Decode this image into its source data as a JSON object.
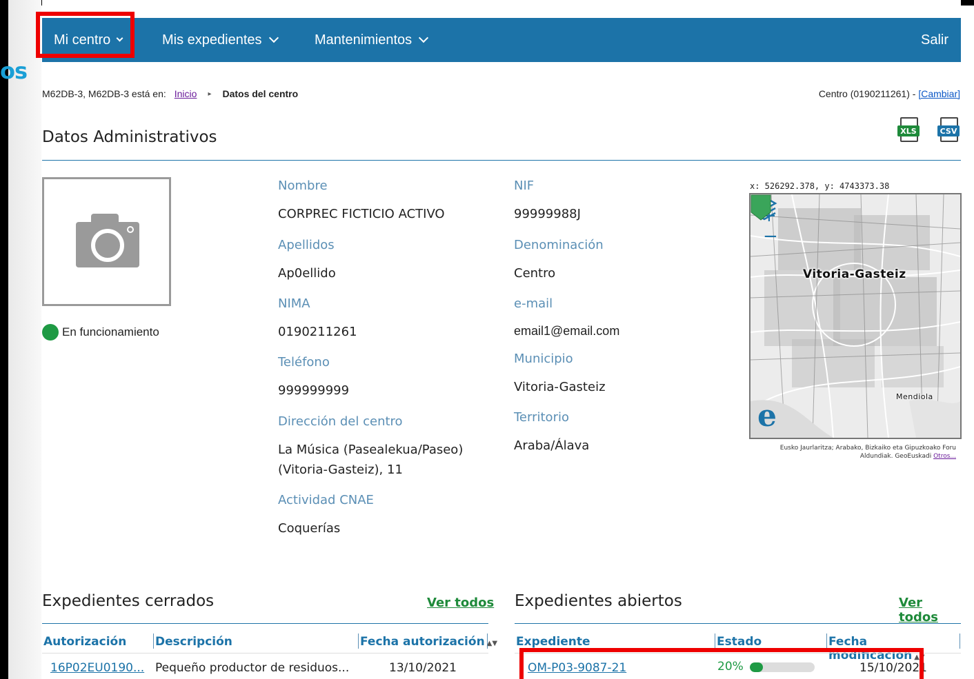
{
  "nav": {
    "items": [
      {
        "label": "Mi centro"
      },
      {
        "label": "Mis expedientes"
      },
      {
        "label": "Mantenimientos"
      }
    ],
    "salir": "Salir",
    "bg_color": "#1c73a8"
  },
  "breadcrumb": {
    "prefix": "M62DB-3, M62DB-3 está en:",
    "inicio": "Inicio",
    "current": "Datos del centro"
  },
  "centro": {
    "label": "Centro (0190211261) - ",
    "cambiar": "[Cambiar]"
  },
  "section": {
    "title": "Datos Administrativos",
    "export_xls": "XLS",
    "export_csv": "CSV"
  },
  "status": {
    "text": "En funcionamiento",
    "color": "#1e9a44"
  },
  "fields": {
    "nombre": {
      "label": "Nombre",
      "value": "CORPREC FICTICIO ACTIVO"
    },
    "apellidos": {
      "label": "Apellidos",
      "value": "Ap0ellido"
    },
    "nima": {
      "label": "NIMA",
      "value": "0190211261"
    },
    "telefono": {
      "label": "Teléfono",
      "value": "999999999"
    },
    "direccion": {
      "label": "Dirección del centro",
      "value_line1": "La Música (Pasealekua/Paseo)",
      "value_line2": "(Vitoria-Gasteiz), 11"
    },
    "actividad": {
      "label": "Actividad CNAE",
      "value": "Coquerías"
    },
    "nif": {
      "label": "NIF",
      "value": "99999988J"
    },
    "denominacion": {
      "label": "Denominación",
      "value": "Centro"
    },
    "email": {
      "label": "e-mail",
      "value": "email1@email.com"
    },
    "municipio": {
      "label": "Municipio",
      "value": "Vitoria-Gasteiz"
    },
    "territorio": {
      "label": "Territorio",
      "value": "Araba/Álava"
    }
  },
  "map": {
    "coords": "x: 526292.378, y: 4743373.38",
    "zoom_in": "+",
    "zoom_out": "−",
    "city": "Vitoria-Gasteiz",
    "district": "Mendiola",
    "logo": "e",
    "attribution": "Eusko Jaurlaritza; Arabako, Bizkaiko eta Gipuzkoako Foru Aldundiak. GeoEuskadi",
    "attribution_link": "Otros..."
  },
  "cerrados": {
    "title": "Expedientes cerrados",
    "ver_todos": "Ver todos",
    "headers": [
      "Autorización",
      "Descripción",
      "Fecha autorización"
    ],
    "rows": [
      {
        "autorizacion": "16P02EU0190...",
        "descripcion": "Pequeño productor de residuos...",
        "fecha": "13/10/2021"
      }
    ]
  },
  "abiertos": {
    "title": "Expedientes abiertos",
    "ver_todos": "Ver todos",
    "headers": [
      "Expediente",
      "Estado",
      "Fecha modificación"
    ],
    "rows": [
      {
        "expediente": "OM-P03-9087-21",
        "estado_pct": "20%",
        "progress": 0.2,
        "fecha": "15/10/2021"
      }
    ]
  },
  "side_letters": "os",
  "sort_glyph": "▲▼"
}
